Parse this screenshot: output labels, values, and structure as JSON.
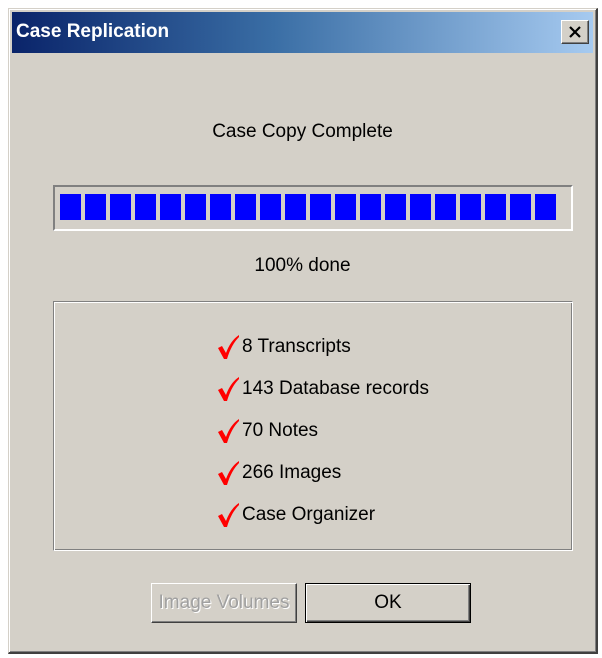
{
  "window": {
    "title": "Case Replication",
    "close_label": "×"
  },
  "status": {
    "message": "Case Copy Complete",
    "progress_fraction": 1.0,
    "progress_label": "100% done",
    "progress_color": "#0000ff"
  },
  "summary": {
    "check_icon": "checkmark-icon",
    "check_color": "#ff0000",
    "items": [
      {
        "label": "8 Transcripts"
      },
      {
        "label": "143 Database records"
      },
      {
        "label": "70 Notes"
      },
      {
        "label": "266 Images"
      },
      {
        "label": "Case Organizer"
      }
    ]
  },
  "buttons": {
    "image_volumes_label": "Image Volumes",
    "image_volumes_enabled": false,
    "ok_label": "OK"
  },
  "colors": {
    "dialog_bg": "#d4d0c8",
    "titlebar_start": "#0a246a",
    "titlebar_end": "#a6caf0"
  }
}
